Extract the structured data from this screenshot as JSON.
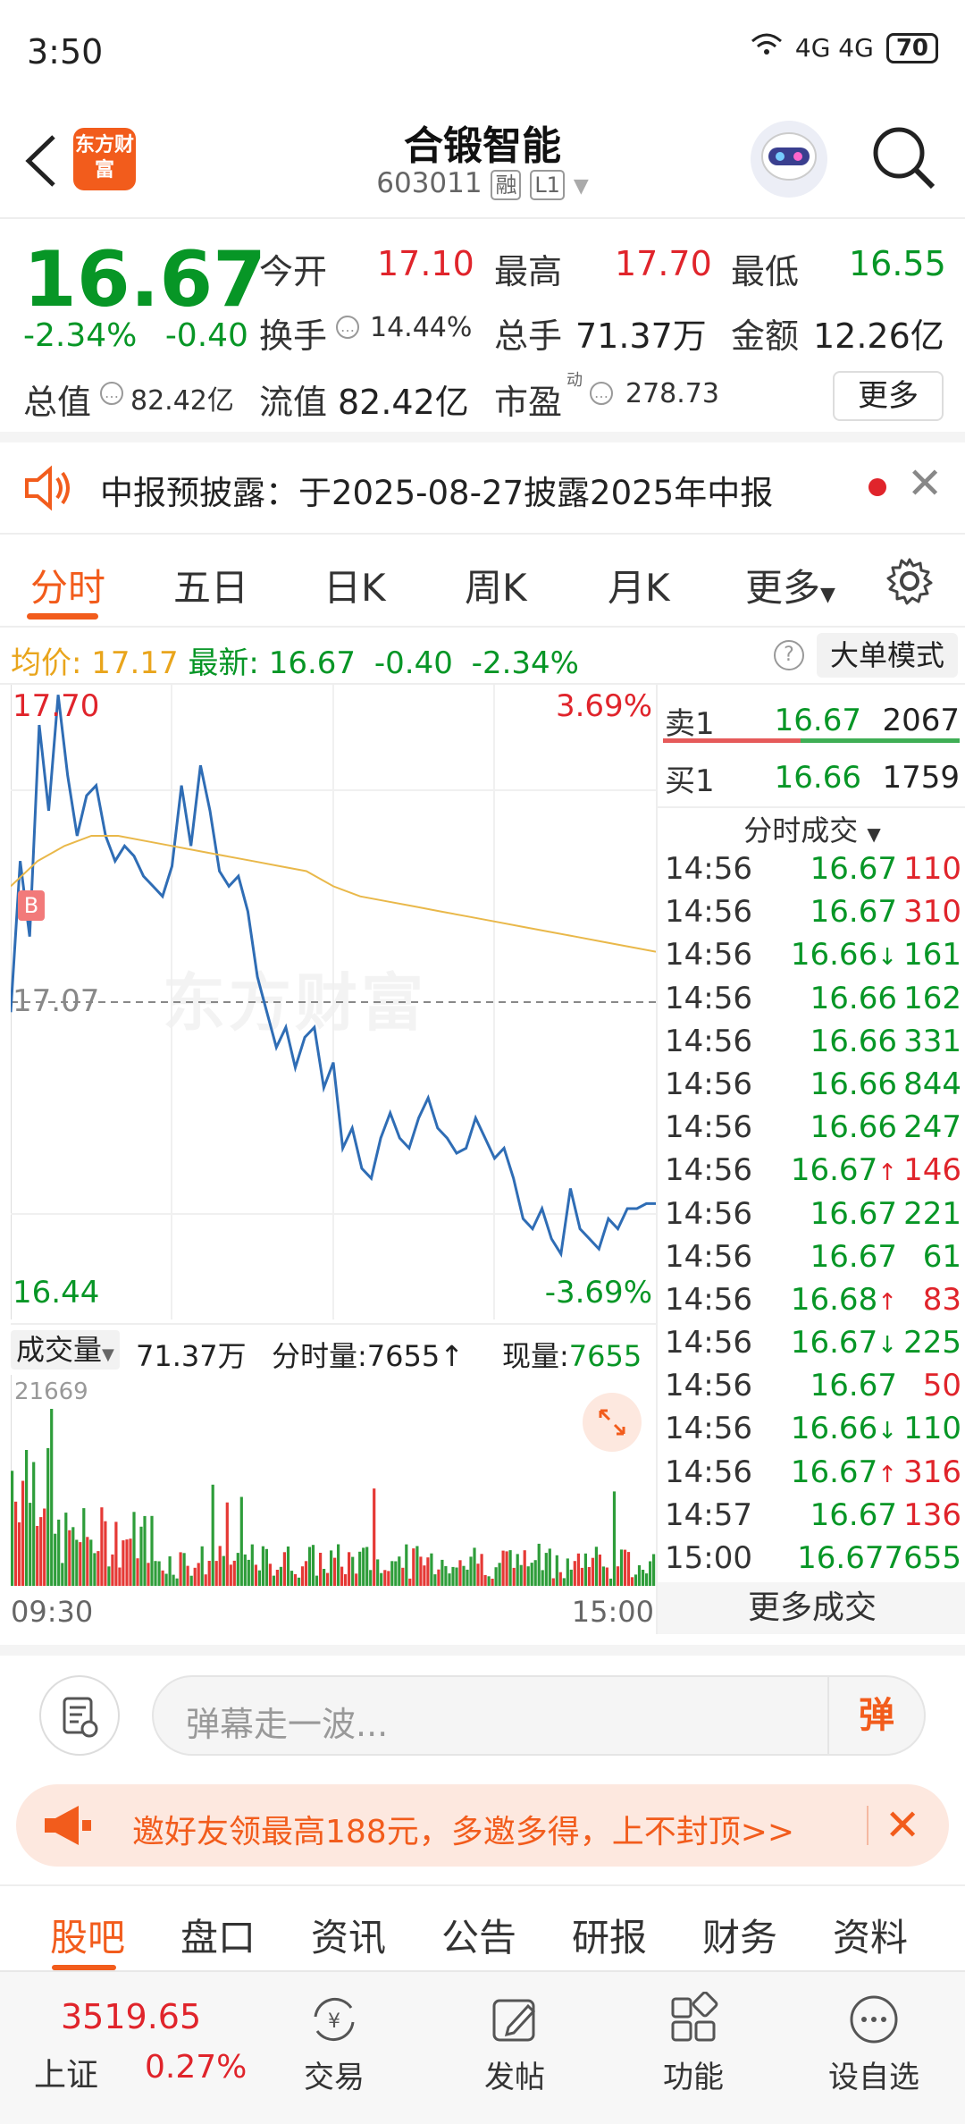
{
  "status_bar": {
    "time": "3:50",
    "network": "4G 4G",
    "battery": "70"
  },
  "header": {
    "logo_text": "东方财富",
    "stock_name": "合锻智能",
    "stock_code": "603011",
    "tags": [
      "融",
      "L1"
    ]
  },
  "quote": {
    "price": "16.67",
    "change_pct": "-2.34%",
    "change_abs": "-0.40",
    "open_label": "今开",
    "open_value": "17.10",
    "high_label": "最高",
    "high_value": "17.70",
    "low_label": "最低",
    "low_value": "16.55",
    "turnover_rate_label": "换手",
    "turnover_rate_value": "14.44%",
    "total_volume_label": "总手",
    "total_volume_value": "71.37万",
    "amount_label": "金额",
    "amount_value": "12.26亿",
    "market_cap_label": "总值",
    "market_cap_value": "82.42亿",
    "float_cap_label": "流值",
    "float_cap_value": "82.42亿",
    "pe_label": "市盈",
    "pe_sup": "动",
    "pe_value": "278.73",
    "more_label": "更多"
  },
  "notice": {
    "text": "中报预披露：于2025-08-27披露2025年中报"
  },
  "tabs": [
    "分时",
    "五日",
    "日K",
    "周K",
    "月K",
    "更多"
  ],
  "summary": {
    "avg_label": "均价:",
    "avg_value": "17.17",
    "latest_label": "最新:",
    "latest_value": "16.67",
    "latest_chg": "-0.40",
    "latest_pct": "-2.34%",
    "mode_button": "大单模式"
  },
  "chart": {
    "y_top": "17.70",
    "y_top_pct": "3.69%",
    "y_mid": "17.07",
    "y_bottom": "16.44",
    "y_bottom_pct": "-3.69%",
    "watermark": "东方财富",
    "buy_marker": "B",
    "volume_label": "成交量",
    "volume_total": "71.37万",
    "period_volume": "分时量:7655↑",
    "current_volume_label": "现量:",
    "current_volume_value": "7655",
    "volume_max": "21669",
    "x_start": "09:30",
    "x_end": "15:00"
  },
  "chart_data": {
    "type": "line",
    "series": [
      {
        "values": [
          17.05,
          17.35,
          17.2,
          17.62,
          17.45,
          17.68,
          17.52,
          17.4,
          17.48,
          17.5,
          17.4,
          17.35,
          17.38,
          17.36,
          17.32,
          17.3,
          17.28,
          17.34,
          17.5,
          17.38,
          17.54,
          17.45,
          17.33,
          17.3,
          17.32,
          17.25,
          17.12,
          17.05,
          16.98,
          17.02,
          16.94,
          17.0,
          17.02,
          16.9,
          16.95,
          16.78,
          16.82,
          16.74,
          16.72,
          16.8,
          16.85,
          16.8,
          16.78,
          16.84,
          16.88,
          16.82,
          16.8,
          16.77,
          16.78,
          16.84,
          16.8,
          16.76,
          16.78,
          16.72,
          16.64,
          16.62,
          16.66,
          16.6,
          16.57,
          16.7,
          16.62,
          16.6,
          16.58,
          16.64,
          16.62,
          16.66,
          16.66,
          16.67,
          16.67
        ]
      },
      {
        "values": [
          17.3,
          17.35,
          17.38,
          17.4,
          17.4,
          17.39,
          17.38,
          17.37,
          17.36,
          17.35,
          17.34,
          17.33,
          17.3,
          17.28,
          17.27,
          17.26,
          17.25,
          17.24,
          17.23,
          17.22,
          17.21,
          17.2,
          17.19,
          17.18,
          17.17
        ]
      }
    ],
    "ylim": [
      16.44,
      17.7
    ]
  },
  "orderbook": {
    "sell1_label": "卖1",
    "sell1_price": "16.67",
    "sell1_vol": "2067",
    "buy1_label": "买1",
    "buy1_price": "16.66",
    "buy1_vol": "1759",
    "ticks_header": "分时成交",
    "ticks": [
      {
        "t": "14:56",
        "p": "16.67",
        "v": "110",
        "pc": "green",
        "vc": "red"
      },
      {
        "t": "14:56",
        "p": "16.67",
        "v": "310",
        "pc": "green",
        "vc": "red"
      },
      {
        "t": "14:56",
        "p": "16.66↓",
        "v": "161",
        "pc": "green",
        "vc": "green"
      },
      {
        "t": "14:56",
        "p": "16.66",
        "v": "162",
        "pc": "green",
        "vc": "green"
      },
      {
        "t": "14:56",
        "p": "16.66",
        "v": "331",
        "pc": "green",
        "vc": "green"
      },
      {
        "t": "14:56",
        "p": "16.66",
        "v": "844",
        "pc": "green",
        "vc": "green"
      },
      {
        "t": "14:56",
        "p": "16.66",
        "v": "247",
        "pc": "green",
        "vc": "green"
      },
      {
        "t": "14:56",
        "p": "16.67↑",
        "v": "146",
        "pc": "green",
        "vc": "red"
      },
      {
        "t": "14:56",
        "p": "16.67",
        "v": "221",
        "pc": "green",
        "vc": "green"
      },
      {
        "t": "14:56",
        "p": "16.67",
        "v": "61",
        "pc": "green",
        "vc": "green"
      },
      {
        "t": "14:56",
        "p": "16.68↑",
        "v": "83",
        "pc": "green",
        "vc": "red"
      },
      {
        "t": "14:56",
        "p": "16.67↓",
        "v": "225",
        "pc": "green",
        "vc": "green"
      },
      {
        "t": "14:56",
        "p": "16.67",
        "v": "50",
        "pc": "green",
        "vc": "red"
      },
      {
        "t": "14:56",
        "p": "16.66↓",
        "v": "110",
        "pc": "green",
        "vc": "green"
      },
      {
        "t": "14:56",
        "p": "16.67↑",
        "v": "316",
        "pc": "green",
        "vc": "red"
      },
      {
        "t": "14:57",
        "p": "16.67",
        "v": "136",
        "pc": "green",
        "vc": "red"
      },
      {
        "t": "15:00",
        "p": "16.67",
        "v": "7655",
        "pc": "green",
        "vc": "green"
      }
    ],
    "more_label": "更多成交"
  },
  "danmu": {
    "placeholder": "弹幕走一波...",
    "send_label": "弹"
  },
  "promo": {
    "text": "邀好友领最高188元，多邀多得，上不封顶>>"
  },
  "bottom_tabs": [
    "股吧",
    "盘口",
    "资讯",
    "公告",
    "研报",
    "财务",
    "资料"
  ],
  "navbar": {
    "index_value": "3519.65",
    "index_name": "上证",
    "index_pct": "0.27%",
    "items": [
      "交易",
      "发帖",
      "功能",
      "设自选"
    ]
  },
  "colors": {
    "up": "#e0242b",
    "down": "#079626",
    "accent": "#f25c1c",
    "price_line": "#2f6db5",
    "avg_line": "#e9b84a"
  }
}
